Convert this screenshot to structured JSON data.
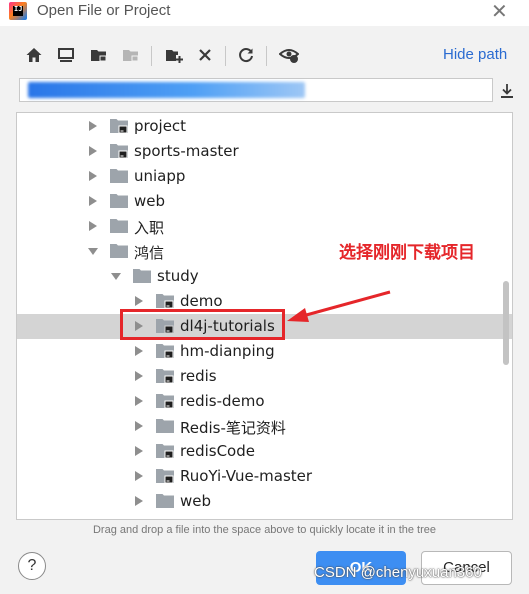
{
  "window": {
    "title": "Open File or Project",
    "app_logo_text": "IJ"
  },
  "toolbar": {
    "buttons": [
      {
        "name": "home-icon"
      },
      {
        "name": "desktop-icon"
      },
      {
        "name": "project-folder-icon"
      },
      {
        "name": "module-folder-icon"
      },
      {
        "name": "new-folder-icon"
      },
      {
        "name": "delete-icon"
      },
      {
        "name": "refresh-icon"
      },
      {
        "name": "show-hidden-icon"
      }
    ],
    "hide_path_label": "Hide path"
  },
  "path": {
    "value": "",
    "note": "path text is blurred/redacted"
  },
  "tree": {
    "items": [
      {
        "label": "project",
        "expanded": false,
        "badge": true
      },
      {
        "label": "sports-master",
        "expanded": false,
        "badge": true
      },
      {
        "label": "uniapp",
        "expanded": false,
        "badge": false
      },
      {
        "label": "web",
        "expanded": false,
        "badge": false
      },
      {
        "label": "入职",
        "expanded": false,
        "badge": false
      },
      {
        "label": "鸿信",
        "expanded": true,
        "badge": false
      },
      {
        "label": "study",
        "expanded": true,
        "badge": false
      },
      {
        "label": "demo",
        "expanded": false,
        "badge": true
      },
      {
        "label": "dl4j-tutorials",
        "expanded": false,
        "badge": true,
        "selected": true
      },
      {
        "label": "hm-dianping",
        "expanded": false,
        "badge": true
      },
      {
        "label": "redis",
        "expanded": false,
        "badge": true
      },
      {
        "label": "redis-demo",
        "expanded": false,
        "badge": true
      },
      {
        "label": "Redis-笔记资料",
        "expanded": false,
        "badge": false
      },
      {
        "label": "redisCode",
        "expanded": false,
        "badge": true
      },
      {
        "label": "RuoYi-Vue-master",
        "expanded": false,
        "badge": true
      },
      {
        "label": "web",
        "expanded": false,
        "badge": false
      }
    ]
  },
  "annotation": {
    "text": "选择刚刚下载项目",
    "color": "#e5262a"
  },
  "hint": "Drag and drop a file into the space above to quickly locate it in the tree",
  "buttons": {
    "help": "?",
    "ok": "OK",
    "cancel": "Cancel"
  },
  "watermark": "CSDN @chenyuxuan360",
  "colors": {
    "accent": "#3d8ef2",
    "link": "#2a6bd1",
    "selection": "#d4d4d4"
  }
}
